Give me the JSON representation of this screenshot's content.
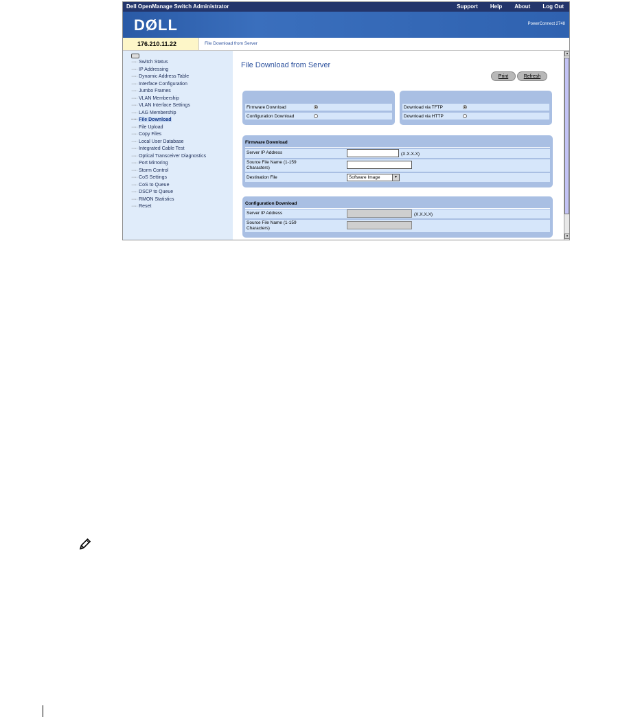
{
  "topbar": {
    "title": "Dell OpenManage Switch Administrator",
    "links": [
      "Support",
      "Help",
      "About",
      "Log Out"
    ]
  },
  "brand": {
    "logo": "DØLL",
    "model": "PowerConnect 2748"
  },
  "ip_address": "176.210.11.22",
  "breadcrumb": "File Download from Server",
  "sidebar": {
    "items": [
      "Switch Status",
      "IP Addressing",
      "Dynamic Address Table",
      "Interface Configuration",
      "Jumbo Frames",
      "VLAN Membership",
      "VLAN Interface Settings",
      "LAG Membership",
      "File Download",
      "File Upload",
      "Copy Files",
      "Local User Database",
      "Integrated Cable Test",
      "Optical Transceiver Diagnostics",
      "Port Mirroring",
      "Storm Control",
      "CoS Settings",
      "CoS to Queue",
      "DSCP to Queue",
      "RMON Statistics",
      "Reset"
    ],
    "active_index": 8
  },
  "main": {
    "title": "File Download from Server",
    "print_label": "Print",
    "refresh_label": "Refresh",
    "download_type": {
      "firmware_label": "Firmware Download",
      "configuration_label": "Configuration Download",
      "selected": "firmware"
    },
    "download_via": {
      "tftp_label": "Download via TFTP",
      "http_label": "Download via HTTP",
      "selected": "tftp"
    },
    "firmware": {
      "heading": "Firmware Download",
      "server_ip_label": "Server IP Address",
      "server_ip_value": "",
      "ip_hint": "(X.X.X.X)",
      "source_file_label_1": "Source File Name (1-159",
      "source_file_label_2": "Characters)",
      "source_file_value": "",
      "destination_label": "Destination File",
      "destination_value": "Software Image"
    },
    "configuration": {
      "heading": "Configuration Download",
      "server_ip_label": "Server IP Address",
      "ip_hint": "(X.X.X.X)",
      "source_file_label_1": "Source File Name (1-159",
      "source_file_label_2": "Characters)"
    }
  },
  "icons": {
    "note": "pencil-note-icon"
  }
}
